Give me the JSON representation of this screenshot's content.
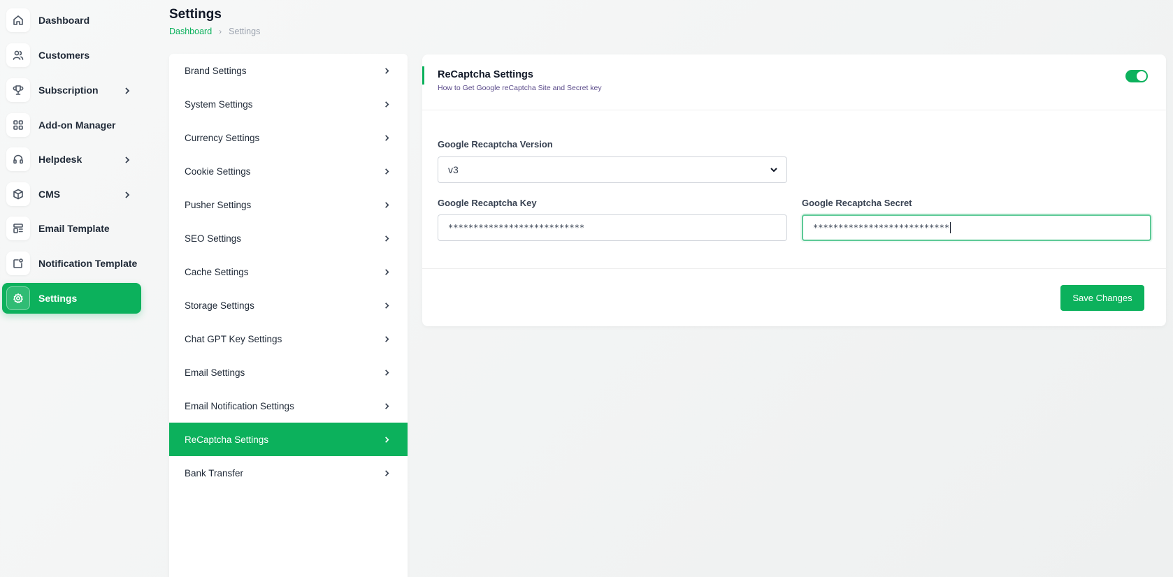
{
  "sidebar": {
    "items": [
      {
        "label": "Dashboard",
        "icon": "home-icon"
      },
      {
        "label": "Customers",
        "icon": "users-icon"
      },
      {
        "label": "Subscription",
        "icon": "trophy-icon"
      },
      {
        "label": "Add-on Manager",
        "icon": "grid-icon"
      },
      {
        "label": "Helpdesk",
        "icon": "headset-icon"
      },
      {
        "label": "CMS",
        "icon": "box-icon"
      },
      {
        "label": "Email Template",
        "icon": "template-icon"
      },
      {
        "label": "Notification Template",
        "icon": "notification-icon"
      },
      {
        "label": "Settings",
        "icon": "gear-icon"
      }
    ],
    "active": "Settings"
  },
  "header": {
    "title": "Settings",
    "breadcrumb": {
      "home": "Dashboard",
      "current": "Settings",
      "separator": "›"
    }
  },
  "settings_menu": {
    "items": [
      {
        "label": "Brand Settings"
      },
      {
        "label": "System Settings"
      },
      {
        "label": "Currency Settings"
      },
      {
        "label": "Cookie Settings"
      },
      {
        "label": "Pusher Settings"
      },
      {
        "label": "SEO Settings"
      },
      {
        "label": "Cache Settings"
      },
      {
        "label": "Storage Settings"
      },
      {
        "label": "Chat GPT Key Settings"
      },
      {
        "label": "Email Settings"
      },
      {
        "label": "Email Notification Settings"
      },
      {
        "label": "ReCaptcha Settings"
      },
      {
        "label": "Bank Transfer"
      }
    ],
    "active": "ReCaptcha Settings"
  },
  "recaptcha": {
    "title": "ReCaptcha Settings",
    "help_link": "How to Get Google reCaptcha Site and Secret key",
    "enabled": true,
    "version": {
      "label": "Google Recaptcha Version",
      "value": "v3"
    },
    "key": {
      "label": "Google Recaptcha Key",
      "value": "***************************"
    },
    "secret": {
      "label": "Google Recaptcha Secret",
      "value": "***************************"
    },
    "save_label": "Save Changes"
  },
  "colors": {
    "accent": "#0cb15c",
    "help_link": "#5b4b8a"
  }
}
